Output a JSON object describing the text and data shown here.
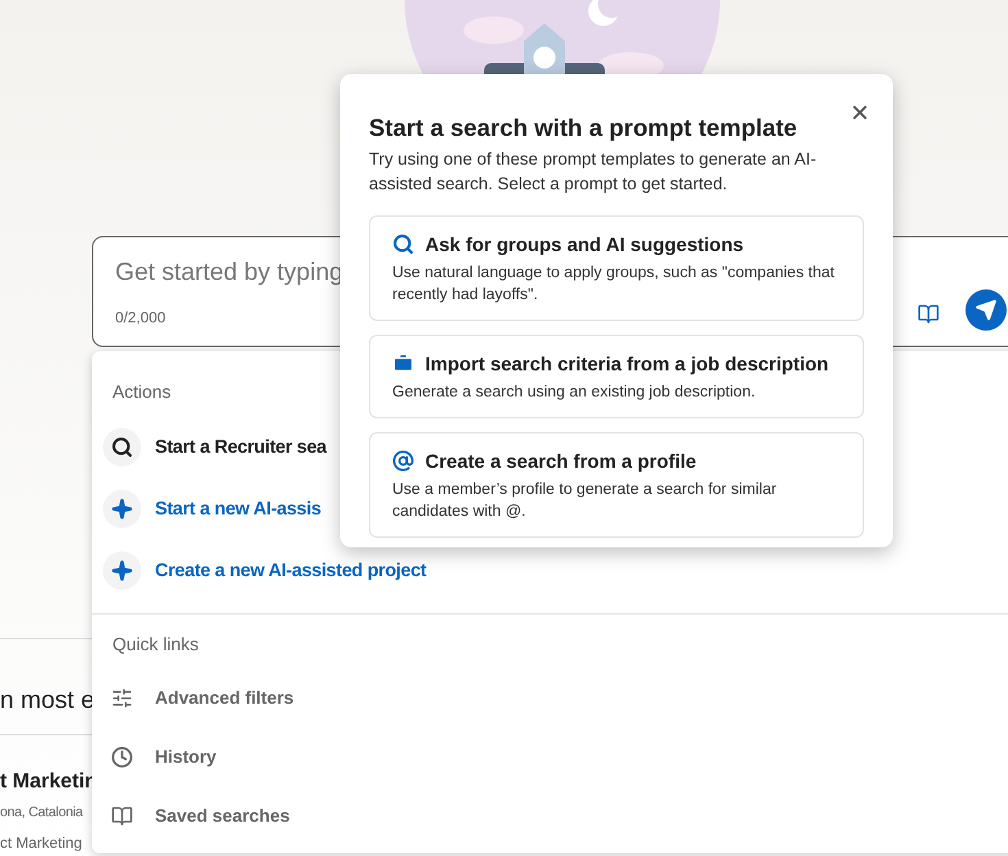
{
  "search_box": {
    "placeholder": "Get started by typing",
    "counter": "0/2,000"
  },
  "background": {
    "heading": "n most e",
    "result_title": "t Marketin",
    "result_location": "ona, Catalonia",
    "result_subtitle": "ct Marketing"
  },
  "dropdown": {
    "sections": [
      {
        "title": "Actions",
        "items": [
          {
            "kind": "search",
            "label": "Start a Recruiter sea",
            "accent": false
          },
          {
            "kind": "sparkle",
            "label": "Start a new AI-assis",
            "accent": true
          },
          {
            "kind": "sparkle",
            "label": "Create a new AI-assisted project",
            "accent": true
          }
        ]
      },
      {
        "title": "Quick links",
        "items": [
          {
            "kind": "filters",
            "label": "Advanced filters",
            "accent": false
          },
          {
            "kind": "history",
            "label": "History",
            "accent": false
          },
          {
            "kind": "book",
            "label": "Saved searches",
            "accent": false
          }
        ]
      }
    ]
  },
  "popover": {
    "title": "Start a search with a prompt template",
    "description": "Try using one of these prompt templates to generate an AI-assisted search. Select a prompt to get started.",
    "templates": [
      {
        "kind": "search",
        "title": "Ask for groups and AI suggestions",
        "description": "Use natural language to apply groups, such as \"companies that recently had layoffs\"."
      },
      {
        "kind": "briefcase",
        "title": "Import search criteria from a job description",
        "description": "Generate a search using an existing job description."
      },
      {
        "kind": "at",
        "title": "Create a search from a profile",
        "description": "Use a member’s profile to generate a search for similar candidates with @."
      }
    ]
  }
}
